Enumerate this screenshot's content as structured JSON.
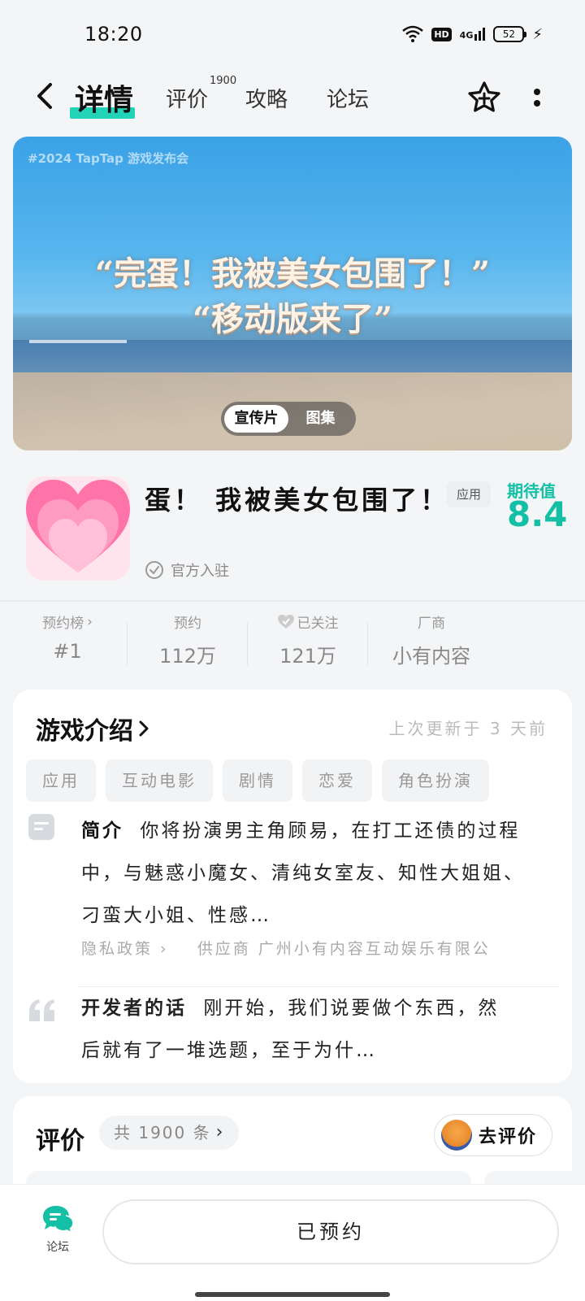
{
  "status_bar": {
    "time": "18:20",
    "hd": "HD",
    "network": "4G",
    "battery": "52"
  },
  "nav": {
    "tabs": [
      {
        "label": "详情"
      },
      {
        "label": "评价",
        "badge": "1900"
      },
      {
        "label": "攻略"
      },
      {
        "label": "论坛"
      }
    ]
  },
  "banner": {
    "tag": "#2024 TapTap 游戏发布会",
    "line1": "“完蛋！我被美女包围了！”",
    "line2": "“移动版来了”",
    "toggle": [
      "宣传片",
      "图集"
    ]
  },
  "app": {
    "title": "蛋！ 我被美女包围了！",
    "badge": "应用",
    "expect_label": "期待值",
    "expect_score": "8.4",
    "official": "官方入驻"
  },
  "stats": [
    {
      "label": "预约榜",
      "value": "#1"
    },
    {
      "label": "预约",
      "value": "112万"
    },
    {
      "label": "已关注",
      "value": "121万"
    },
    {
      "label": "厂商",
      "value": "小有内容"
    }
  ],
  "intro": {
    "title": "游戏介绍",
    "updated": "上次更新于 3 天前",
    "tags": [
      "应用",
      "互动电影",
      "剧情",
      "恋爱",
      "角色扮演"
    ],
    "summary_label": "简介",
    "summary": "你将扮演男主角顾易，在打工还债的过程中，与魅惑小魔女、清纯女室友、知性大姐姐、刁蛮大小姐、性感…",
    "privacy": "隐私政策",
    "supplier": "供应商 广州小有内容互动娱乐有限公",
    "dev_label": "开发者的话",
    "dev_text": "刚开始，我们说要做个东西，然后就有了一堆选题，至于为什…"
  },
  "reviews": {
    "title": "评价",
    "count": "共 1900 条",
    "go_review": "去评价"
  },
  "bottom": {
    "forum_label": "论坛",
    "reserved": "已预约"
  },
  "colors": {
    "accent": "#14c0a5",
    "highlight": "#22d3b8"
  }
}
